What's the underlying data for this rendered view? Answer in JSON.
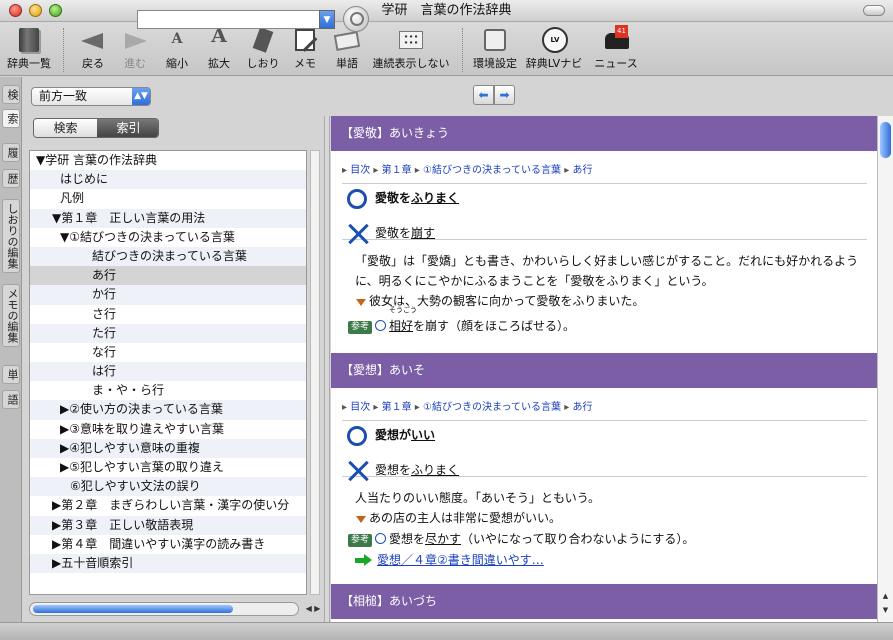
{
  "window": {
    "title": "学研　言葉の作法辞典"
  },
  "toolbar": [
    {
      "id": "dict-list",
      "label": "辞典一覧",
      "icon": "book-icon",
      "enabled": true
    },
    {
      "id": "back",
      "label": "戻る",
      "icon": "back-arrow-icon",
      "enabled": true
    },
    {
      "id": "forward",
      "label": "進む",
      "icon": "forward-arrow-icon",
      "enabled": false
    },
    {
      "id": "shrink",
      "label": "縮小",
      "icon": "font-smaller-icon",
      "enabled": true
    },
    {
      "id": "enlarge",
      "label": "拡大",
      "icon": "font-larger-icon",
      "enabled": true
    },
    {
      "id": "bookmark",
      "label": "しおり",
      "icon": "bookmark-icon",
      "enabled": true
    },
    {
      "id": "memo",
      "label": "メモ",
      "icon": "memo-icon",
      "enabled": true
    },
    {
      "id": "word",
      "label": "単語",
      "icon": "word-card-icon",
      "enabled": true
    },
    {
      "id": "continuous",
      "label": "連続表示しない",
      "icon": "grid-icon",
      "enabled": true
    },
    {
      "id": "settings",
      "label": "環境設定",
      "icon": "settings-icon",
      "enabled": true
    },
    {
      "id": "navi",
      "label": "辞典LVナビ",
      "icon": "clock-icon",
      "enabled": true
    },
    {
      "id": "news",
      "label": "ニュース",
      "icon": "mailbox-icon",
      "enabled": true,
      "badge": "41"
    }
  ],
  "side_tabs": [
    {
      "label": "検",
      "active": false
    },
    {
      "label": "索",
      "active": true
    },
    {
      "label": "履",
      "active": false
    },
    {
      "label": "歴",
      "active": false
    },
    {
      "label": "しおりの編集",
      "active": false
    },
    {
      "label": "メモの編集",
      "active": false
    },
    {
      "label": "単",
      "active": false
    },
    {
      "label": "語",
      "active": false
    }
  ],
  "search": {
    "mode": "前方一致",
    "query": "",
    "segment": {
      "search": "検索",
      "index": "索引",
      "selected": "index"
    }
  },
  "tree": [
    {
      "label": "▼学研 言葉の作法辞典",
      "level": 0
    },
    {
      "label": "はじめに",
      "level": 2
    },
    {
      "label": "凡例",
      "level": 2
    },
    {
      "label": "▼第１章　正しい言葉の用法",
      "level": 1
    },
    {
      "label": "▼①結びつきの決まっている言葉",
      "level": 2
    },
    {
      "label": "結びつきの決まっている言葉",
      "level": 4
    },
    {
      "label": "あ行",
      "level": 4,
      "selected": true
    },
    {
      "label": "か行",
      "level": 4
    },
    {
      "label": "さ行",
      "level": 4
    },
    {
      "label": "た行",
      "level": 4
    },
    {
      "label": "な行",
      "level": 4
    },
    {
      "label": "は行",
      "level": 4
    },
    {
      "label": "ま・や・ら行",
      "level": 4
    },
    {
      "label": "▶②使い方の決まっている言葉",
      "level": 2
    },
    {
      "label": "▶③意味を取り違えやすい言葉",
      "level": 2
    },
    {
      "label": "▶④犯しやすい意味の重複",
      "level": 2
    },
    {
      "label": "▶⑤犯しやすい言葉の取り違え",
      "level": 2
    },
    {
      "label": "⑥犯しやすい文法の誤り",
      "level": 3
    },
    {
      "label": "▶第２章　まぎらわしい言葉・漢字の使い分",
      "level": 1
    },
    {
      "label": "▶第３章　正しい敬語表現",
      "level": 1
    },
    {
      "label": "▶第４章　間違いやすい漢字の読み書き",
      "level": 1
    },
    {
      "label": "▶五十音順索引",
      "level": 1
    }
  ],
  "entries": [
    {
      "head": "【愛敬】あいきょう",
      "breadcrumb": [
        "目次",
        "第１章",
        "①結びつきの決まっている言葉",
        "あ行"
      ],
      "correct": {
        "pre": "愛敬を",
        "u": "ふりまく"
      },
      "wrong": {
        "pre": "愛敬を",
        "u": "崩す"
      },
      "desc": "「愛敬」は「愛嬌」とも書き、かわいらしく好ましい感じがすること。だれにも好かれるように、明るくにこやかにふるまうことを「愛敬をふりまく」という。",
      "example": "彼女は、大勢の観客に向かって愛敬をふりまいた。",
      "ref": {
        "tag": "参考",
        "ruby_rt": "そうごう",
        "ruby_base": "相好",
        "rest": "を崩す（顔をほころばせる）。"
      }
    },
    {
      "head": "【愛想】あいそ",
      "breadcrumb": [
        "目次",
        "第１章",
        "①結びつきの決まっている言葉",
        "あ行"
      ],
      "correct": {
        "pre": "愛想が",
        "u": "いい"
      },
      "wrong": {
        "pre": "愛想を",
        "u": "ふりまく"
      },
      "desc": "人当たりのいい態度。「あいそう」ともいう。",
      "example": "あの店の主人は非常に愛想がいい。",
      "ref": {
        "tag": "参考",
        "pre": "愛想を",
        "u": "尽かす",
        "rest": "（いやになって取り合わないようにする）。"
      },
      "link": "愛想／４章②書き間違いやす…"
    },
    {
      "head": "【相槌】あいづち"
    }
  ]
}
